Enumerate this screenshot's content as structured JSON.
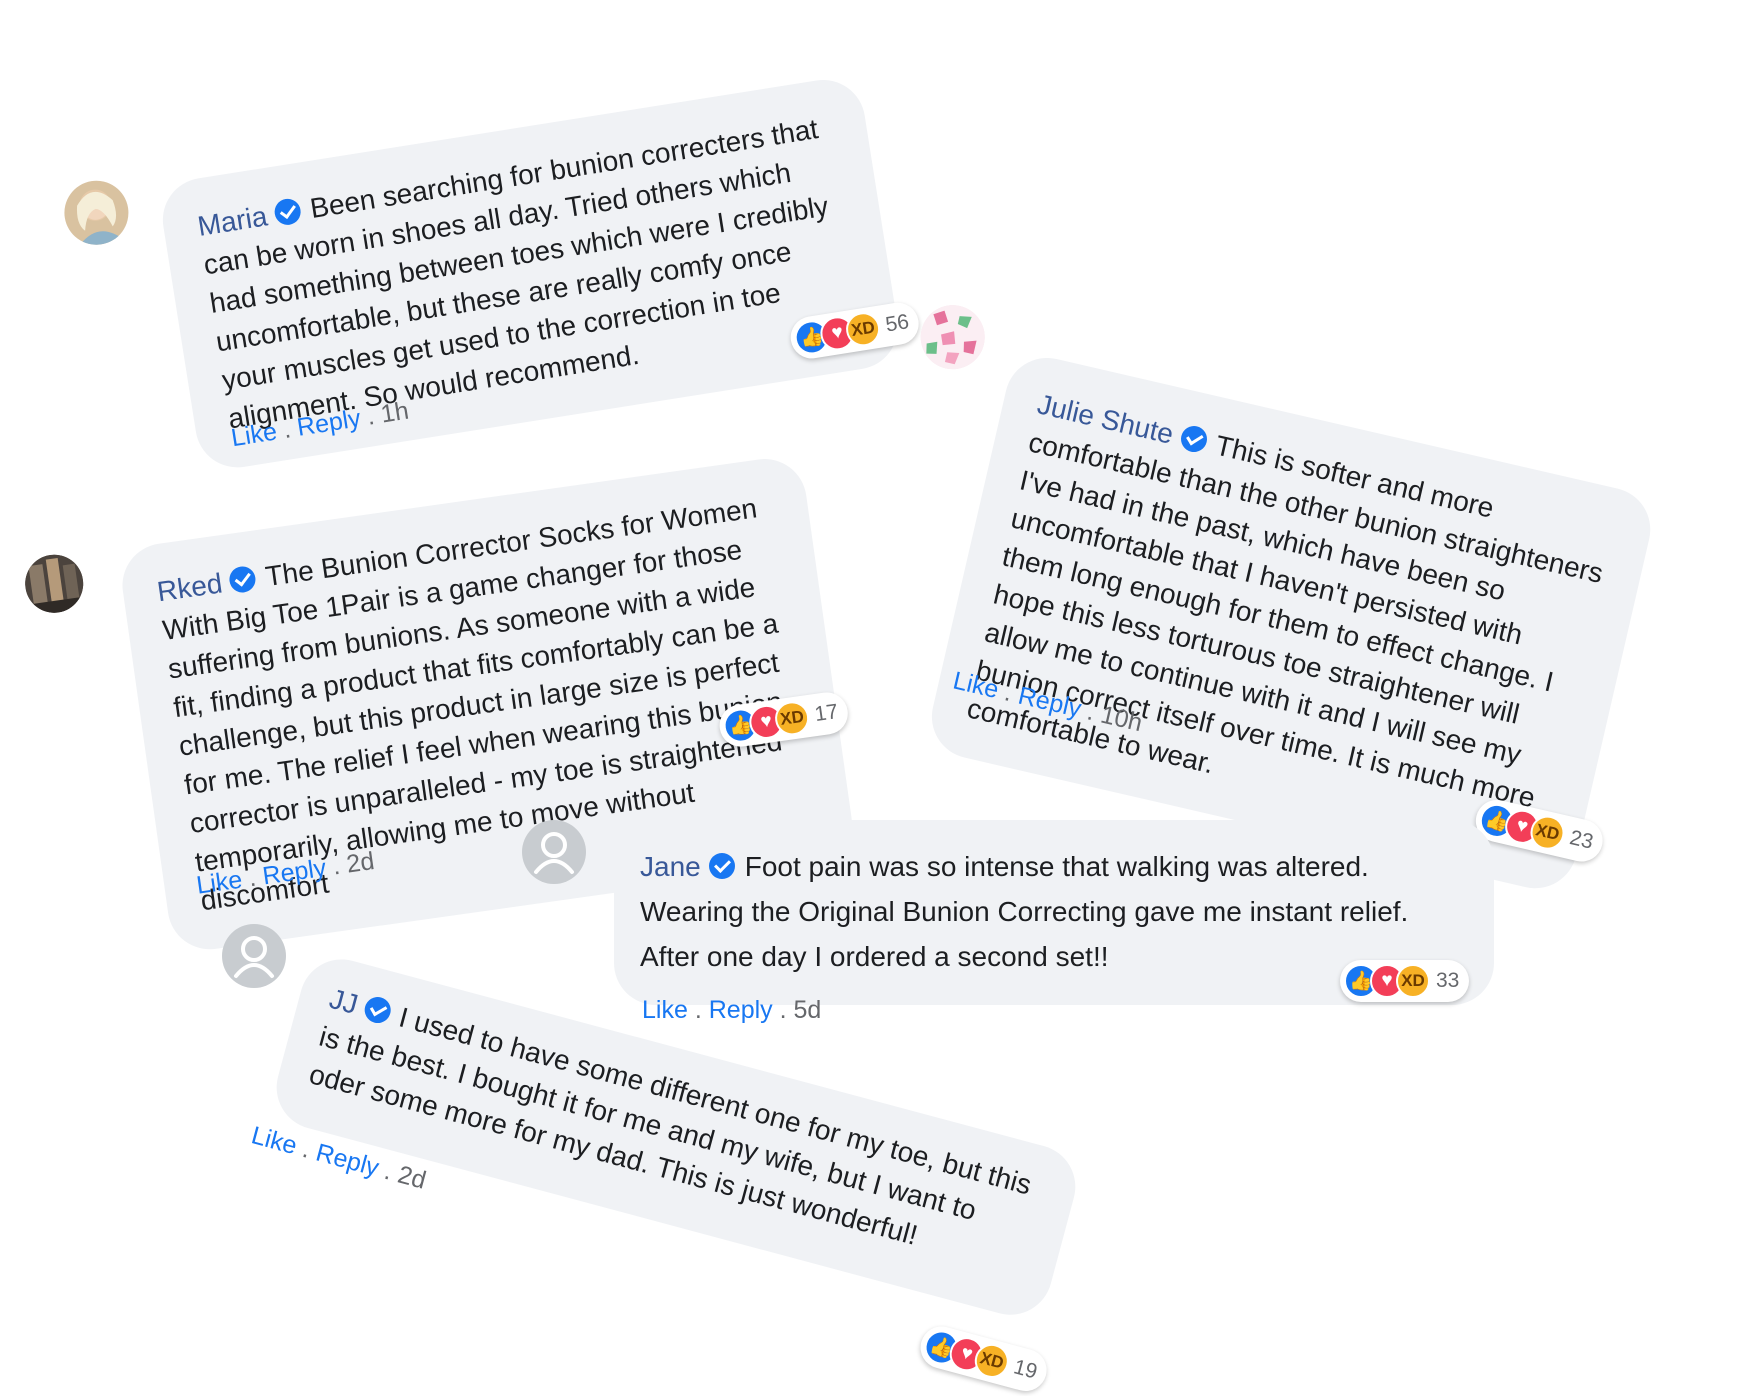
{
  "colors": {
    "bubble_bg": "#f0f2f5",
    "name": "#385898",
    "link": "#1877f2",
    "verified": "#1877f2",
    "like": "#1877f2",
    "love": "#f33e58",
    "haha": "#f7b125"
  },
  "icons": {
    "verified": "verified-badge-icon",
    "reactions": [
      "like-reaction-icon",
      "love-reaction-icon",
      "haha-reaction-icon"
    ],
    "default_avatar": "default-avatar-icon"
  },
  "comments": [
    {
      "name": "Maria",
      "text": "Been searching for bunion correcters that can be worn in shoes all day. Tried others which had something between toes which were I credibly uncomfortable, but these are really comfy once your muscles get used to the correction in toe alignment. So would recommend.",
      "like": "Like",
      "sep1": ".",
      "reply": "Reply",
      "sep2": ".",
      "time": "1h",
      "reactions": "56",
      "avatar": "photo"
    },
    {
      "name": "Julie Shute",
      "text": "This is softer and more comfortable than the other bunion straighteners I've had in the past, which have been so uncomfortable that I haven't persisted with them long enough for them to effect change. I hope this less torturous toe straightener will allow me to continue with it and I will see my bunion correct itself over time. It is much more comfortable to wear.",
      "like": "Like",
      "sep1": ".",
      "reply": "Reply",
      "sep2": ".",
      "time": "10h",
      "reactions": "23",
      "avatar": "pattern"
    },
    {
      "name": "Rked",
      "text": "The Bunion Corrector Socks for Women With Big Toe 1Pair is a game changer for those suffering from bunions. As someone with a wide fit, finding a product that fits comfortably can be a challenge, but this product in large size is perfect for me. The relief I feel when wearing this bunion corrector is unparalleled - my toe is straightened temporarily, allowing me to move without discomfort",
      "like": "Like",
      "sep1": ".",
      "reply": "Reply",
      "sep2": ".",
      "time": "2d",
      "reactions": "17",
      "avatar": "photo-dark"
    },
    {
      "name": "Jane",
      "text": "Foot pain was so intense that walking was altered. Wearing the Original Bunion Correcting gave me instant relief. After one day I ordered a second set!!",
      "like": "Like",
      "sep1": ".",
      "reply": "Reply",
      "sep2": ".",
      "time": "5d",
      "reactions": "33",
      "avatar": "default"
    },
    {
      "name": "JJ",
      "text": "I used to have some different one for my toe, but this is the best. I bought it for me and my wife, but I want to oder some more for my dad. This is just wonderful!",
      "like": "Like",
      "sep1": ".",
      "reply": "Reply",
      "sep2": ".",
      "time": "2d",
      "reactions": "19",
      "avatar": "default"
    }
  ]
}
